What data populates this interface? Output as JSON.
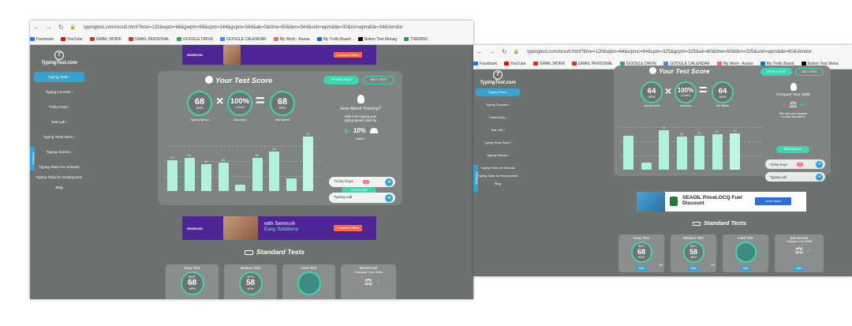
{
  "left": {
    "url": "typingtest.com/result.html?time=120&wpm=68&gwpm=68&cpm=344&gcpm=344&ak=0&time=60&tlen=344&unit=wpm&tle=30&tsl=wpm&tle=34&Vendor",
    "bookmarks": [
      "Facebook",
      "YouTube",
      "GMAIL WORK",
      "GMAIL PERSONAL",
      "GOOGLE DRIVE",
      "GOOGLE CALENDAR",
      "My Work - Asana",
      "My Trello Board",
      "Notion Test Manag",
      "TREMBIC"
    ],
    "logo": "TypingTest.com",
    "sidebar": [
      "Typing Tests",
      "Typing Courses",
      "Tricky Keys",
      "Test Lab",
      "Typing Tests Race",
      "Typing Games",
      "Typing Tests For Schools",
      "Typing Tests for Employment",
      "Blog"
    ],
    "feedback": "Feedback",
    "ad": {
      "brand": "SEMRUSH",
      "headline_1": "with Semrush",
      "headline_2": "Easy Solutions",
      "cta": "Compare Offers"
    },
    "score_title": "Your Test Score",
    "btn_retake": "RETAKE TEST",
    "btn_next": "NEXT TEST",
    "speed": {
      "value": "68",
      "unit": "WPM",
      "label": "Typing Speed"
    },
    "accuracy": {
      "value": "100%",
      "unit": "Correct",
      "label": "Accuracy"
    },
    "net": {
      "value": "68",
      "unit": "WPM",
      "label": "Net Speed"
    },
    "tip": {
      "title": "How About Training?",
      "body_1": "With more typing your",
      "body_2": "typing speed could be",
      "delta": "10%",
      "delta_note": "faster*"
    },
    "train_now": "TRAIN NOW",
    "tricky": {
      "label": "Tricky Keys",
      "count": "4"
    },
    "lab": {
      "label": "Typing Lab"
    },
    "chart_data": {
      "type": "bar",
      "values": [
        51,
        55,
        45,
        48,
        10,
        55,
        66,
        21,
        91
      ],
      "labels": [
        "51",
        "55",
        "45",
        "48",
        "",
        "55",
        "66",
        "",
        "91"
      ],
      "ylim": [
        0,
        100
      ]
    },
    "standard_tests": "Standard Tests",
    "cards": [
      {
        "title": "Easy Test",
        "best": "BEST",
        "value": "68",
        "unit": "WPM"
      },
      {
        "title": "Medium Test",
        "best": "BEST",
        "value": "58",
        "unit": "WPM"
      },
      {
        "title": "Hard Test",
        "best": "",
        "value": "",
        "unit": ""
      },
      {
        "title": "Benchmark",
        "sub": "Compare Your Skills"
      }
    ]
  },
  "right": {
    "url": "typingtest.com/result.html?time=120&wpm=64&wpmc=64&cpm=325&gcpm=325&ak=60&time=60&tlen=325&unit=wpm&tle=60&Vendor",
    "bookmarks": [
      "Facebook",
      "YouTube",
      "GMAIL WORK",
      "GMAIL PERSONAL",
      "GOOGLE DRIVE",
      "GOOGLE CALENDAR",
      "My Work - Asana",
      "My Trello Board",
      "Notion Test Mana"
    ],
    "logo": "TypingTest.com",
    "sidebar": [
      "Typing Tests",
      "Typing Courses",
      "Tricky Keys",
      "Test Lab",
      "Typing Tests Race",
      "Typing Games",
      "Typing Tests for Schools",
      "Typing Tests for Employment",
      "Blog"
    ],
    "feedback": "Feedback",
    "score_title": "Your Test Score",
    "btn_retake": "RETAKE TEST",
    "btn_next": "NEXT TEST",
    "speed": {
      "value": "64",
      "unit": "WPM",
      "label": "Typing Speed"
    },
    "accuracy": {
      "value": "100%",
      "unit": "Correct",
      "label": "Accuracy"
    },
    "net": {
      "value": "64",
      "unit": "WPM",
      "label": "Net Speed"
    },
    "compare": {
      "title": "Compare Your Skills",
      "body_1": "See how you compare",
      "body_2": "to other test takers",
      "btn": "BENCHMARK"
    },
    "tricky": {
      "label": "Tricky Keys",
      "count": "5"
    },
    "lab": {
      "label": "Typing Lab"
    },
    "chart_data": {
      "type": "bar",
      "values": [
        60,
        12,
        70,
        58,
        60,
        62,
        64
      ],
      "labels": [
        "",
        "",
        "70",
        "58",
        "60",
        "62",
        "64"
      ],
      "ylim": [
        0,
        100
      ]
    },
    "ad": {
      "title_1": "SEAOIL PriceLOCQ Fuel",
      "title_2": "Discount",
      "cta": "Learn More"
    },
    "standard_tests": "Standard Tests",
    "cards": [
      {
        "title": "Easy Test",
        "best": "BEST",
        "value": "68",
        "unit": "WPM",
        "start": "Start",
        "pct": "4%"
      },
      {
        "title": "Medium Test",
        "best": "BEST",
        "value": "58",
        "unit": "WPM",
        "start": "Start",
        "pct": "6%"
      },
      {
        "title": "Hard Test",
        "start": "Start"
      },
      {
        "title": "Benchmark",
        "sub": "Compare Your Skills",
        "start": "Start"
      }
    ]
  }
}
